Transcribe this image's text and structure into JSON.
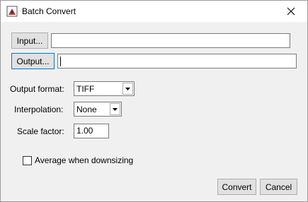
{
  "window": {
    "title": "Batch Convert",
    "icon": "batch-convert-app-icon"
  },
  "input": {
    "button_label": "Input...",
    "value": ""
  },
  "output": {
    "button_label": "Output...",
    "value": ""
  },
  "output_format": {
    "label": "Output format:",
    "selected": "TIFF"
  },
  "interpolation": {
    "label": "Interpolation:",
    "selected": "None"
  },
  "scale_factor": {
    "label": "Scale factor:",
    "value": "1.00"
  },
  "average_downsizing": {
    "label": "Average when downsizing",
    "checked": false
  },
  "actions": {
    "convert_label": "Convert",
    "cancel_label": "Cancel"
  },
  "colors": {
    "focus_border": "#0078d7",
    "button_face": "#e1e1e1",
    "dialog_bg": "#f0f0f0"
  }
}
